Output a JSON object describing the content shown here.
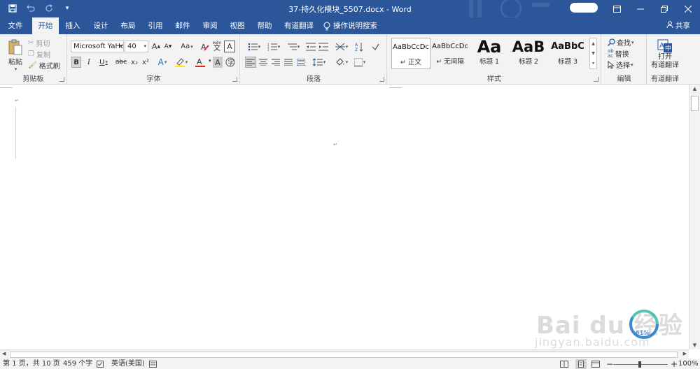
{
  "titlebar": {
    "title": "37-持久化模块_5507.docx - Word",
    "quick_access": [
      "save",
      "undo",
      "redo",
      "customize"
    ]
  },
  "tabs": [
    {
      "label": "文件",
      "active": false
    },
    {
      "label": "开始",
      "active": true
    },
    {
      "label": "插入",
      "active": false
    },
    {
      "label": "设计",
      "active": false
    },
    {
      "label": "布局",
      "active": false
    },
    {
      "label": "引用",
      "active": false
    },
    {
      "label": "邮件",
      "active": false
    },
    {
      "label": "审阅",
      "active": false
    },
    {
      "label": "视图",
      "active": false
    },
    {
      "label": "帮助",
      "active": false
    },
    {
      "label": "有道翻译",
      "active": false
    },
    {
      "label": "操作说明搜索",
      "active": false
    }
  ],
  "share_label": "共享",
  "ribbon": {
    "clipboard": {
      "label": "剪贴板",
      "paste": "粘贴",
      "cut": "剪切",
      "copy": "复制",
      "format_painter": "格式刷"
    },
    "font": {
      "label": "字体",
      "font_name": "Microsoft YaHe",
      "font_size": "40",
      "grow": "A",
      "shrink": "A",
      "change_case": "Aa",
      "bold": "B",
      "italic": "I",
      "underline": "U",
      "strike": "abc",
      "subscript": "x₂",
      "superscript": "x²",
      "char_border": "A",
      "phonetic": "wén",
      "char_shade": "A"
    },
    "paragraph": {
      "label": "段落"
    },
    "styles": {
      "label": "样式",
      "items": [
        {
          "sample": "AaBbCcDc",
          "name": "↵ 正文"
        },
        {
          "sample": "AaBbCcDc",
          "name": "↵ 无间隔"
        },
        {
          "sample": "Aa",
          "name": "标题 1"
        },
        {
          "sample": "AaB",
          "name": "标题 2"
        },
        {
          "sample": "AaBbC",
          "name": "标题 3"
        }
      ]
    },
    "editing": {
      "label": "编辑",
      "find": "查找",
      "replace": "替换",
      "select": "选择"
    },
    "youdao": {
      "label": "有道翻译",
      "open_line1": "打开",
      "open_line2": "有道翻译"
    }
  },
  "statusbar": {
    "page": "第 1 页，共 10 页",
    "words": "459 个字",
    "language": "英语(美国)",
    "zoom": "100%"
  },
  "watermark": {
    "brand": "Bai du 经验",
    "url": "jingyan.baidu.com",
    "percent": "61%"
  },
  "colors": {
    "accent": "#2b579a",
    "ribbon_bg": "#f3f3f3"
  }
}
